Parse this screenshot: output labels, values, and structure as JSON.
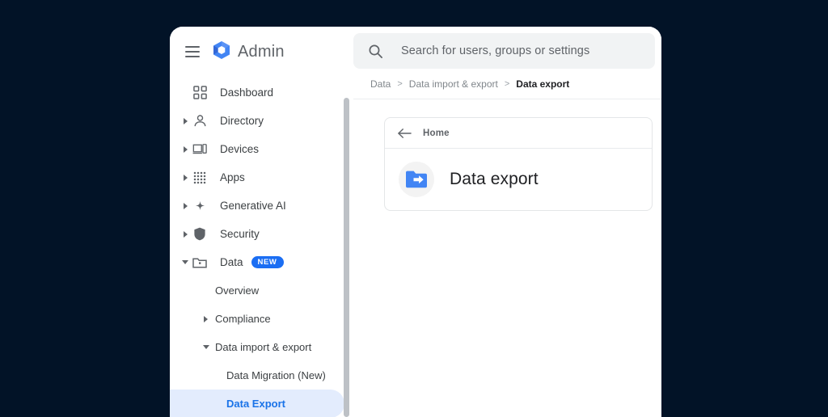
{
  "window": {
    "background_color": "#021327",
    "surface_color": "#ffffff"
  },
  "sidebar": {
    "menu_icon": "hamburger-menu-icon",
    "brand": {
      "logo_icon": "google-admin-hexagon-logo",
      "label": "Admin"
    },
    "scrollbar": {
      "visible": true
    },
    "items": [
      {
        "label": "Dashboard",
        "icon": "dashboard-grid-icon",
        "level": 1,
        "expandable": false,
        "expanded": false,
        "selected": false,
        "badge": ""
      },
      {
        "label": "Directory",
        "icon": "person-icon",
        "level": 1,
        "expandable": true,
        "expanded": false,
        "selected": false,
        "badge": ""
      },
      {
        "label": "Devices",
        "icon": "device-laptop-phone-icon",
        "level": 1,
        "expandable": true,
        "expanded": false,
        "selected": false,
        "badge": ""
      },
      {
        "label": "Apps",
        "icon": "apps-dots-grid-icon",
        "level": 1,
        "expandable": true,
        "expanded": false,
        "selected": false,
        "badge": ""
      },
      {
        "label": "Generative AI",
        "icon": "sparkle-star-icon",
        "level": 1,
        "expandable": true,
        "expanded": false,
        "selected": false,
        "badge": ""
      },
      {
        "label": "Security",
        "icon": "shield-icon",
        "level": 1,
        "expandable": true,
        "expanded": false,
        "selected": false,
        "badge": ""
      },
      {
        "label": "Data",
        "icon": "folder-data-icon",
        "level": 1,
        "expandable": true,
        "expanded": true,
        "selected": false,
        "badge": "NEW"
      },
      {
        "label": "Overview",
        "icon": "",
        "level": 2,
        "expandable": false,
        "expanded": false,
        "selected": false,
        "badge": ""
      },
      {
        "label": "Compliance",
        "icon": "",
        "level": 2,
        "expandable": true,
        "expanded": false,
        "selected": false,
        "badge": ""
      },
      {
        "label": "Data import & export",
        "icon": "",
        "level": 2,
        "expandable": true,
        "expanded": true,
        "selected": false,
        "badge": ""
      },
      {
        "label": "Data Migration (New)",
        "icon": "",
        "level": 3,
        "expandable": false,
        "expanded": false,
        "selected": false,
        "badge": ""
      },
      {
        "label": "Data Export",
        "icon": "",
        "level": 3,
        "expandable": false,
        "expanded": false,
        "selected": true,
        "badge": ""
      }
    ],
    "badge_color": "#1b6ef3",
    "selected_bg_color": "#e3ecfd",
    "selected_text_color": "#1a73e8"
  },
  "search": {
    "icon": "search-magnifier-icon",
    "placeholder": "Search for users, groups or settings",
    "value": ""
  },
  "breadcrumb": {
    "separator": ">",
    "items": [
      {
        "label": "Data",
        "current": false
      },
      {
        "label": "Data import & export",
        "current": false
      },
      {
        "label": "Data export",
        "current": true
      }
    ]
  },
  "main": {
    "card": {
      "back_icon": "arrow-back-icon",
      "back_label": "Home",
      "item_icon": "data-export-folder-arrow-icon",
      "item_icon_color": "#4285f4",
      "title": "Data export"
    }
  }
}
